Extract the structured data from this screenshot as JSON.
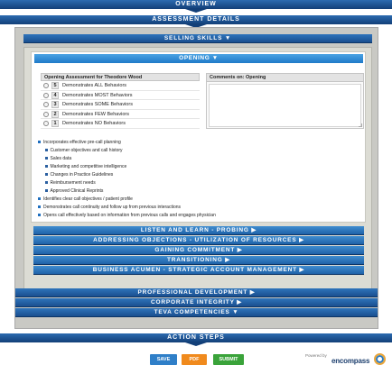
{
  "headers": {
    "overview": "OVERVIEW",
    "assessment_details": "ASSESSMENT DETAILS",
    "action_steps": "ACTION STEPS"
  },
  "selling_skills": {
    "label": "SELLING SKILLS",
    "arrow": "▼"
  },
  "opening": {
    "label": "OPENING",
    "arrow": "▼",
    "assessment_title": "Opening Assessment for Theodore Wood",
    "ratings": [
      {
        "score": "5",
        "label": "Demonstrates ALL Behaviors"
      },
      {
        "score": "4",
        "label": "Demonstrates MOST Behaviors"
      },
      {
        "score": "3",
        "label": "Demonstrates SOME Behaviors"
      },
      {
        "score": "2",
        "label": "Demonstrates FEW Behaviors"
      },
      {
        "score": "1",
        "label": "Demonstrates NO Behaviors"
      }
    ],
    "comments_title": "Comments on: Opening",
    "comments_value": "",
    "behaviors": [
      {
        "text": "Incorporates effective pre-call planning",
        "sub": false
      },
      {
        "text": "Customer objectives and call history",
        "sub": true
      },
      {
        "text": "Sales data",
        "sub": true
      },
      {
        "text": "Marketing and competitive intelligence",
        "sub": true
      },
      {
        "text": "Changes in Practice Guidelines",
        "sub": true
      },
      {
        "text": "Reimbursement needs",
        "sub": true
      },
      {
        "text": "Approved Clinical Reprints",
        "sub": true
      },
      {
        "text": "Identifies clear call objectives / patient profile",
        "sub": false
      },
      {
        "text": "Demonstrates call continuity and follow up from previous interactions",
        "sub": false
      },
      {
        "text": "Opens call effectively based on information from previous calls and engages physician",
        "sub": false
      }
    ]
  },
  "skill_sections": [
    {
      "label": "LISTEN AND LEARN - PROBING",
      "arrow": "▶"
    },
    {
      "label": "ADDRESSING OBJECTIONS - UTILIZATION OF RESOURCES",
      "arrow": "▶"
    },
    {
      "label": "GAINING COMMITMENT",
      "arrow": "▶"
    },
    {
      "label": "TRANSITIONING",
      "arrow": "▶"
    },
    {
      "label": "BUSINESS ACUMEN - STRATEGIC ACCOUNT MANAGEMENT",
      "arrow": "▶"
    }
  ],
  "other_sections": [
    {
      "label": "PROFESSIONAL DEVELOPMENT",
      "arrow": "▶"
    },
    {
      "label": "CORPORATE INTEGRITY",
      "arrow": "▶"
    },
    {
      "label": "TEVA COMPETENCIES",
      "arrow": "▼"
    }
  ],
  "buttons": {
    "save": "SAVE",
    "pdf": "PDF",
    "submit": "SUBMIT"
  },
  "brand": {
    "powered_by": "Powered by",
    "name": "encompass"
  },
  "colors": {
    "primary": "#1a4f8f",
    "save": "#2f7fc8",
    "pdf": "#f08a1d",
    "submit": "#3aa33a"
  }
}
